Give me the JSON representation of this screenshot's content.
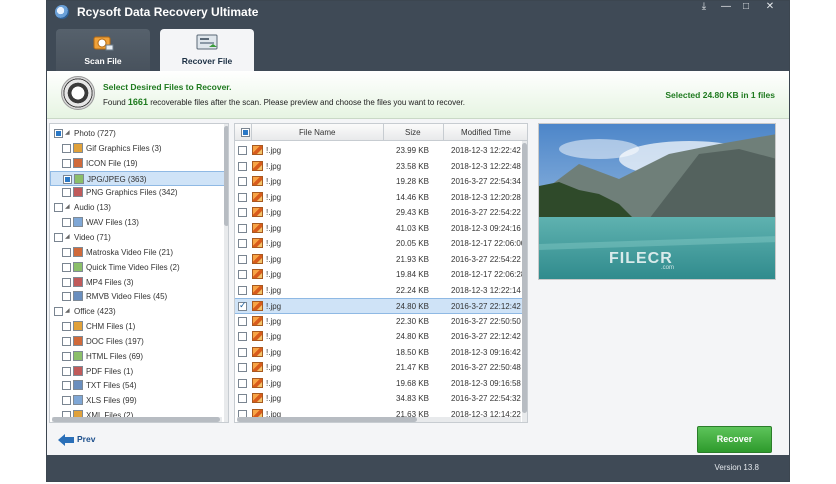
{
  "app": {
    "title": "Rcysoft Data Recovery Ultimate",
    "version": "Version 13.8"
  },
  "window_controls": {
    "download": "⤓",
    "minimize": "—",
    "maximize": "□",
    "close": "✕"
  },
  "tabs": [
    {
      "label": "Scan File"
    },
    {
      "label": "Recover File"
    }
  ],
  "banner": {
    "title": "Select Desired Files to Recover.",
    "desc_prefix": "Found",
    "count": "1661",
    "desc_suffix": "recoverable files after the scan. Please preview and choose the files you want to recover.",
    "selected": "Selected 24.80 KB in 1 files"
  },
  "tree": [
    {
      "label": "Photo (727)",
      "level": 0,
      "state": "partial",
      "icon": "folder-photo-icon"
    },
    {
      "label": "Gif Graphics Files (3)",
      "level": 1,
      "state": "none",
      "icon": "gif-icon"
    },
    {
      "label": "ICON File (19)",
      "level": 1,
      "state": "none",
      "icon": "ico-icon"
    },
    {
      "label": "JPG/JPEG (363)",
      "level": 1,
      "state": "partial",
      "icon": "jpg-icon",
      "selected": true
    },
    {
      "label": "PNG Graphics Files (342)",
      "level": 1,
      "state": "none",
      "icon": "png-icon"
    },
    {
      "label": "Audio (13)",
      "level": 0,
      "state": "none",
      "icon": "folder-audio-icon"
    },
    {
      "label": "WAV Files (13)",
      "level": 1,
      "state": "none",
      "icon": "wav-icon"
    },
    {
      "label": "Video (71)",
      "level": 0,
      "state": "none",
      "icon": "folder-video-icon"
    },
    {
      "label": "Matroska Video File (21)",
      "level": 1,
      "state": "none",
      "icon": "mkv-icon"
    },
    {
      "label": "Quick Time Video Files (2)",
      "level": 1,
      "state": "none",
      "icon": "mov-icon"
    },
    {
      "label": "MP4 Files (3)",
      "level": 1,
      "state": "none",
      "icon": "mp4-icon"
    },
    {
      "label": "RMVB Video Files (45)",
      "level": 1,
      "state": "none",
      "icon": "rmvb-icon"
    },
    {
      "label": "Office (423)",
      "level": 0,
      "state": "none",
      "icon": "folder-office-icon"
    },
    {
      "label": "CHM Files (1)",
      "level": 1,
      "state": "none",
      "icon": "chm-icon"
    },
    {
      "label": "DOC Files (197)",
      "level": 1,
      "state": "none",
      "icon": "doc-icon"
    },
    {
      "label": "HTML Files (69)",
      "level": 1,
      "state": "none",
      "icon": "html-icon"
    },
    {
      "label": "PDF Files (1)",
      "level": 1,
      "state": "none",
      "icon": "pdf-icon"
    },
    {
      "label": "TXT Files (54)",
      "level": 1,
      "state": "none",
      "icon": "txt-icon"
    },
    {
      "label": "XLS Files (99)",
      "level": 1,
      "state": "none",
      "icon": "xls-icon"
    },
    {
      "label": "XML Files (2)",
      "level": 1,
      "state": "none",
      "icon": "xml-icon"
    }
  ],
  "filelist": {
    "columns": [
      "File Name",
      "Size",
      "Modified Time"
    ],
    "rows": [
      {
        "name": "!.jpg",
        "size": "23.99 KB",
        "time": "2018-12-3 12:22:42"
      },
      {
        "name": "!.jpg",
        "size": "23.58 KB",
        "time": "2018-12-3 12:22:48"
      },
      {
        "name": "!.jpg",
        "size": "19.28 KB",
        "time": "2016-3-27 22:54:34"
      },
      {
        "name": "!.jpg",
        "size": "14.46 KB",
        "time": "2018-12-3 12:20:28"
      },
      {
        "name": "!.jpg",
        "size": "29.43 KB",
        "time": "2016-3-27 22:54:22"
      },
      {
        "name": "!.jpg",
        "size": "41.03 KB",
        "time": "2018-12-3 09:24:16"
      },
      {
        "name": "!.jpg",
        "size": "20.05 KB",
        "time": "2018-12-17 22:06:00"
      },
      {
        "name": "!.jpg",
        "size": "21.93 KB",
        "time": "2016-3-27 22:54:22"
      },
      {
        "name": "!.jpg",
        "size": "19.84 KB",
        "time": "2018-12-17 22:06:28"
      },
      {
        "name": "!.jpg",
        "size": "22.24 KB",
        "time": "2018-12-3 12:22:14"
      },
      {
        "name": "!.jpg",
        "size": "24.80 KB",
        "time": "2016-3-27 22:12:42",
        "selected": true
      },
      {
        "name": "!.jpg",
        "size": "22.30 KB",
        "time": "2016-3-27 22:50:50"
      },
      {
        "name": "!.jpg",
        "size": "24.80 KB",
        "time": "2016-3-27 22:12:42"
      },
      {
        "name": "!.jpg",
        "size": "18.50 KB",
        "time": "2018-12-3 09:16:42"
      },
      {
        "name": "!.jpg",
        "size": "21.47 KB",
        "time": "2016-3-27 22:50:48"
      },
      {
        "name": "!.jpg",
        "size": "19.68 KB",
        "time": "2018-12-3 09:16:58"
      },
      {
        "name": "!.jpg",
        "size": "34.83 KB",
        "time": "2016-3-27 22:54:32"
      },
      {
        "name": "!.jpg",
        "size": "21.63 KB",
        "time": "2018-12-3 12:14:22"
      }
    ]
  },
  "preview": {
    "watermark": "FILECR",
    "watermark_sub": ".com"
  },
  "footer": {
    "prev_label": "Prev",
    "recover_label": "Recover"
  }
}
